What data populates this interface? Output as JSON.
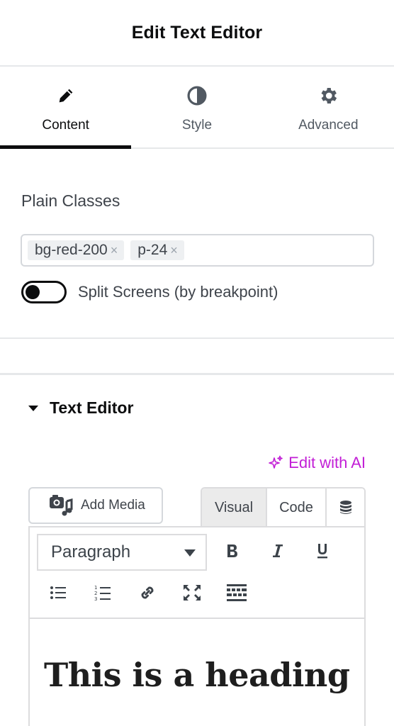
{
  "header": {
    "title": "Edit Text Editor"
  },
  "tabs": [
    {
      "label": "Content",
      "icon": "pencil-icon",
      "active": true
    },
    {
      "label": "Style",
      "icon": "half-circle-icon",
      "active": false
    },
    {
      "label": "Advanced",
      "icon": "gear-icon",
      "active": false
    }
  ],
  "plain_classes": {
    "label": "Plain Classes",
    "tags": [
      {
        "text": "bg-red-200",
        "remove": "×"
      },
      {
        "text": "p-24",
        "remove": "×"
      }
    ],
    "split_screens": {
      "label": "Split Screens (by breakpoint)",
      "on": false
    }
  },
  "text_editor": {
    "title": "Text Editor",
    "ai_link": "Edit with AI",
    "add_media": "Add Media",
    "mode_tabs": {
      "visual": "Visual",
      "code": "Code",
      "db_icon": "database-icon"
    },
    "format": "Paragraph",
    "toolbar_icons": [
      "bold-icon",
      "italic-icon",
      "underline-icon",
      "bullet-list-icon",
      "numbered-list-icon",
      "link-icon",
      "fullscreen-icon",
      "toolbar-toggle-icon"
    ],
    "heading": "This is a heading"
  },
  "colors": {
    "accent_ai": "#c21ed6",
    "text_dark": "#0c0d0e",
    "border": "#d5d8dc"
  }
}
